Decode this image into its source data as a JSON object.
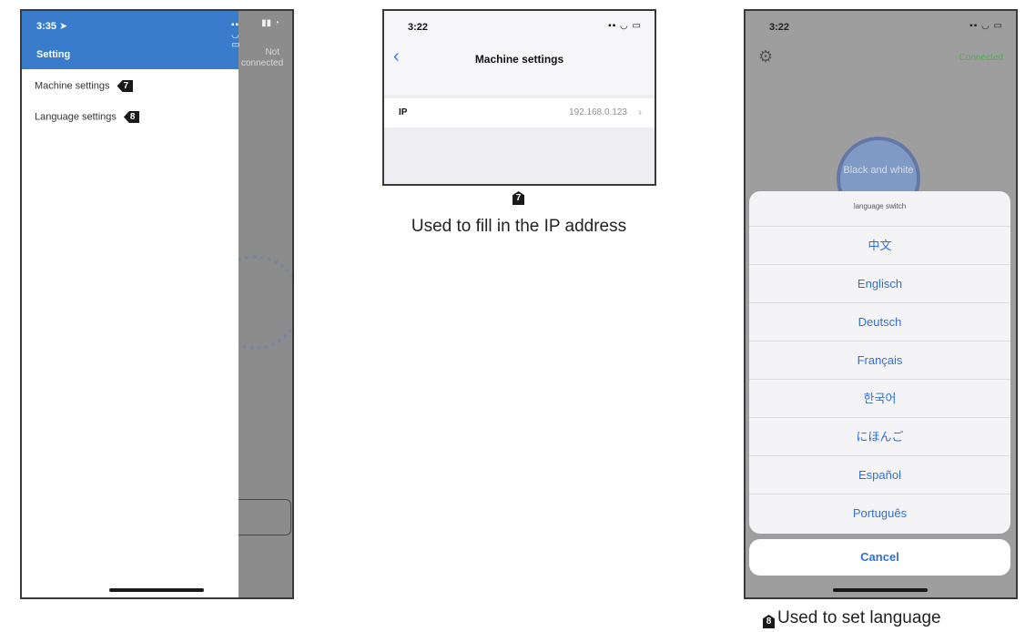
{
  "phone1": {
    "time": "3:35 ➤",
    "title": "Setting",
    "menu": [
      {
        "label": "Machine settings",
        "badge": "7"
      },
      {
        "label": "Language settings",
        "badge": "8"
      }
    ],
    "background_status": "Not connected"
  },
  "phone2": {
    "time": "3:22",
    "nav_title": "Machine settings",
    "ip_label": "IP",
    "ip_value": "192.168.0.123"
  },
  "caption7": {
    "badge": "7",
    "text": "Used to fill in the IP address"
  },
  "phone3": {
    "time": "3:22",
    "connected": "Connected",
    "dial_text": "Black and white",
    "sheet_title": "language switch",
    "languages": [
      "中文",
      "Englisch",
      "Deutsch",
      "Français",
      "한국어",
      "にほんご",
      "Español",
      "Português"
    ],
    "cancel": "Cancel",
    "accent_color": "#2f6fd6"
  },
  "caption8": {
    "badge": "8",
    "text": "Used to set language"
  },
  "colors": {
    "drawer_header": "#3a7ccc",
    "link_blue": "#2f6fd6",
    "connected_green": "#4caf50"
  }
}
